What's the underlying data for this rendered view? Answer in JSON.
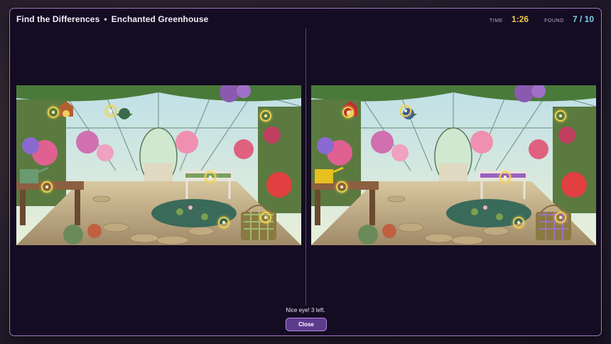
{
  "header": {
    "game_title": "Find the Differences",
    "separator": "•",
    "level_name": "Enchanted Greenhouse",
    "time_label": "TIME",
    "time_value": "1:26",
    "found_label": "FOUND",
    "found_value": "7 / 10"
  },
  "colors": {
    "accent_border": "#a77cd0",
    "time_color": "#f2c94c",
    "found_color": "#7ed0e8",
    "marker_color": "#f2d24c",
    "button_fill": "#5c3a8c"
  },
  "scenes": {
    "left": {
      "name": "original-scene",
      "watering_can": "green",
      "bench_cushion": "green",
      "picnic_basket": "green-check"
    },
    "right": {
      "name": "modified-scene",
      "watering_can": "yellow",
      "bench_cushion": "purple",
      "picnic_basket": "purple-check"
    }
  },
  "found_markers_count": 7,
  "footer": {
    "feedback": "Nice eye! 3 left.",
    "close_label": "Close"
  }
}
